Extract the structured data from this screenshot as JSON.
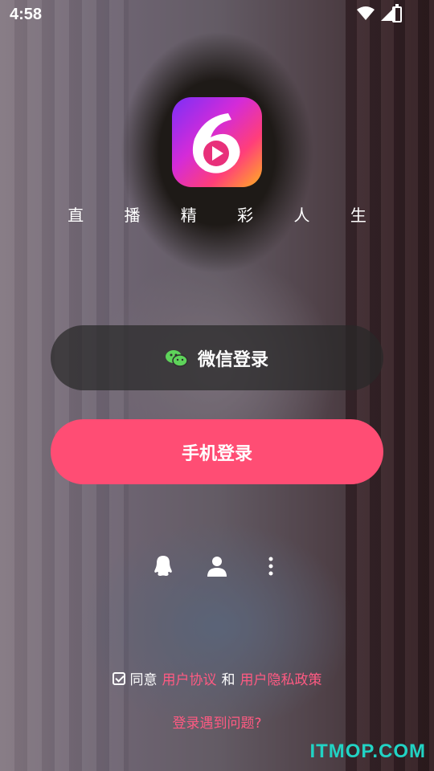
{
  "status_bar": {
    "time": "4:58"
  },
  "app": {
    "slogan": "直 播 精 彩 人 生"
  },
  "login": {
    "wechat_label": "微信登录",
    "phone_label": "手机登录"
  },
  "alt_login": {
    "icons": [
      "qq-icon",
      "user-icon",
      "more-vertical-icon"
    ]
  },
  "agreement": {
    "prefix": "同意",
    "user_agreement": "用户协议",
    "conjunction": "和",
    "privacy_policy": "用户隐私政策",
    "checked": true
  },
  "help_link": "登录遇到问题?",
  "watermark": "ITMOP.COM",
  "colors": {
    "accent": "#ff4d74",
    "link": "#ff5a82",
    "watermark": "#21d3c4"
  }
}
